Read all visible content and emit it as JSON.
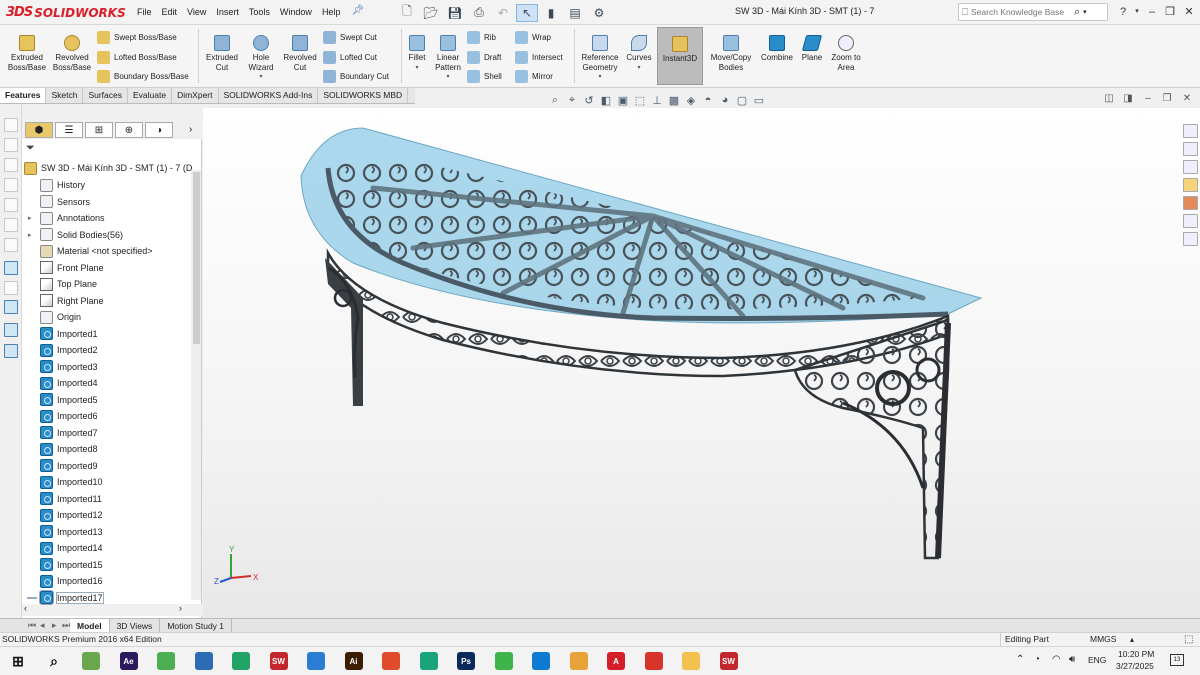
{
  "app": {
    "brand_prefix": "3DS",
    "brand": "SOLIDWORKS",
    "doc_title": "SW 3D - Mái Kính 3D - SMT (1) - 7",
    "colors": {
      "brand_red": "#d8202a",
      "accent_blue": "#2a8cc8",
      "glass": "#8fcbe6"
    }
  },
  "menu": [
    "File",
    "Edit",
    "View",
    "Insert",
    "Tools",
    "Window",
    "Help"
  ],
  "quick_access_icons": [
    "new-icon",
    "open-icon",
    "save-icon",
    "print-icon",
    "undo-icon",
    "select-icon",
    "traffic-light-icon",
    "file-props-icon",
    "options-icon"
  ],
  "search": {
    "placeholder": "Search Knowledge Base"
  },
  "commands": {
    "extruded_boss": "Extruded Boss/Base",
    "revolved_boss": "Revolved Boss/Base",
    "swept_boss": "Swept Boss/Base",
    "lofted_boss": "Lofted Boss/Base",
    "boundary_boss": "Boundary Boss/Base",
    "extruded_cut": "Extruded Cut",
    "hole_wizard": "Hole Wizard",
    "revolved_cut": "Revolved Cut",
    "swept_cut": "Swept Cut",
    "lofted_cut": "Lofted Cut",
    "boundary_cut": "Boundary Cut",
    "fillet": "Fillet",
    "linear_pattern": "Linear Pattern",
    "rib": "Rib",
    "draft": "Draft",
    "shell": "Shell",
    "wrap": "Wrap",
    "intersect": "Intersect",
    "mirror": "Mirror",
    "reference_geometry": "Reference Geometry",
    "curves": "Curves",
    "instant3d": "Instant3D",
    "move_copy": "Move/Copy Bodies",
    "combine": "Combine",
    "plane": "Plane",
    "zoom_area": "Zoom to Area"
  },
  "tabs": [
    "Features",
    "Sketch",
    "Surfaces",
    "Evaluate",
    "DimXpert",
    "SOLIDWORKS Add-Ins",
    "SOLIDWORKS MBD"
  ],
  "tree": {
    "root": "SW 3D - Mái Kính 3D - SMT (1) - 7  (D",
    "items": [
      {
        "label": "History",
        "icon": "history-icon",
        "expand": false
      },
      {
        "label": "Sensors",
        "icon": "sensor-icon",
        "expand": false
      },
      {
        "label": "Annotations",
        "icon": "annotations-icon",
        "expand": true
      },
      {
        "label": "Solid Bodies(56)",
        "icon": "solid-bodies-icon",
        "expand": true
      },
      {
        "label": "Material <not specified>",
        "icon": "material-icon",
        "expand": false
      },
      {
        "label": "Front Plane",
        "icon": "plane-icon",
        "expand": false
      },
      {
        "label": "Top Plane",
        "icon": "plane-icon",
        "expand": false
      },
      {
        "label": "Right Plane",
        "icon": "plane-icon",
        "expand": false
      },
      {
        "label": "Origin",
        "icon": "origin-icon",
        "expand": false
      },
      {
        "label": "Imported1",
        "icon": "body-icon",
        "expand": false
      },
      {
        "label": "Imported2",
        "icon": "body-icon",
        "expand": false
      },
      {
        "label": "Imported3",
        "icon": "body-icon",
        "expand": false
      },
      {
        "label": "Imported4",
        "icon": "body-icon",
        "expand": false
      },
      {
        "label": "Imported5",
        "icon": "body-icon",
        "expand": false
      },
      {
        "label": "Imported6",
        "icon": "body-icon",
        "expand": false
      },
      {
        "label": "Imported7",
        "icon": "body-icon",
        "expand": false
      },
      {
        "label": "Imported8",
        "icon": "body-icon",
        "expand": false
      },
      {
        "label": "Imported9",
        "icon": "body-icon",
        "expand": false
      },
      {
        "label": "Imported10",
        "icon": "body-icon",
        "expand": false
      },
      {
        "label": "Imported11",
        "icon": "body-icon",
        "expand": false
      },
      {
        "label": "Imported12",
        "icon": "body-icon",
        "expand": false
      },
      {
        "label": "Imported13",
        "icon": "body-icon",
        "expand": false
      },
      {
        "label": "Imported14",
        "icon": "body-icon",
        "expand": false
      },
      {
        "label": "Imported15",
        "icon": "body-icon",
        "expand": false
      },
      {
        "label": "Imported16",
        "icon": "body-icon",
        "expand": false
      },
      {
        "label": "Imported17",
        "icon": "body-icon",
        "expand": false
      }
    ]
  },
  "triad": {
    "x": "X",
    "y": "Y",
    "z": "Z"
  },
  "bottom_tabs": [
    "Model",
    "3D Views",
    "Motion Study 1"
  ],
  "status": {
    "edition": "SOLIDWORKS Premium 2016 x64 Edition",
    "mode": "Editing Part",
    "units": "MMGS"
  },
  "taskbar": {
    "apps": [
      {
        "label": "",
        "color": "#6aa84f"
      },
      {
        "label": "Ae",
        "color": "#2b1a5e"
      },
      {
        "label": "",
        "color": "#4caf50"
      },
      {
        "label": "",
        "color": "#2d6cb4"
      },
      {
        "label": "",
        "color": "#21a366"
      },
      {
        "label": "SW",
        "color": "#c4262e"
      },
      {
        "label": "",
        "color": "#2b7cd3"
      },
      {
        "label": "Ai",
        "color": "#3b1d00"
      },
      {
        "label": "",
        "color": "#e04b2a"
      },
      {
        "label": "",
        "color": "#19a37a"
      },
      {
        "label": "Ps",
        "color": "#0b2a5c"
      },
      {
        "label": "",
        "color": "#3db44a"
      },
      {
        "label": "",
        "color": "#0f7ad1"
      },
      {
        "label": "",
        "color": "#e8a23a"
      },
      {
        "label": "A",
        "color": "#d41f2a"
      },
      {
        "label": "",
        "color": "#d9342b"
      },
      {
        "label": "",
        "color": "#f2c14e"
      },
      {
        "label": "SW",
        "color": "#c4262e"
      }
    ],
    "lang": "ENG",
    "time": "10:20 PM",
    "date": "3/27/2025",
    "notif": "13"
  }
}
